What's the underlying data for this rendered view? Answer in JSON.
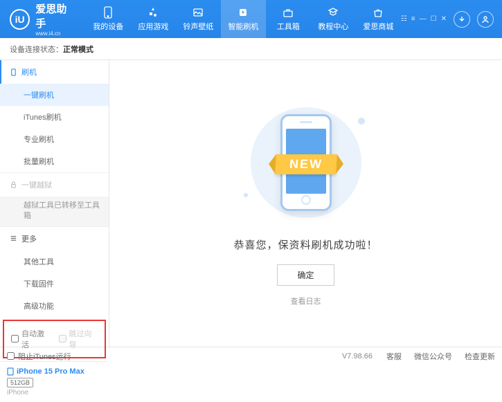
{
  "logo": {
    "glyph": "iU",
    "title": "爱思助手",
    "url": "www.i4.cn"
  },
  "nav": [
    {
      "label": "我的设备"
    },
    {
      "label": "应用游戏"
    },
    {
      "label": "铃声壁纸"
    },
    {
      "label": "智能刷机"
    },
    {
      "label": "工具箱"
    },
    {
      "label": "教程中心"
    },
    {
      "label": "爱思商城"
    }
  ],
  "status": {
    "prefix": "设备连接状态：",
    "value": "正常模式"
  },
  "sidebar": {
    "flash": {
      "header": "刷机",
      "items": [
        "一键刷机",
        "iTunes刷机",
        "专业刷机",
        "批量刷机"
      ]
    },
    "jailbreak": {
      "header": "一键越狱",
      "note": "越狱工具已转移至工具箱"
    },
    "more": {
      "header": "更多",
      "items": [
        "其他工具",
        "下载固件",
        "高级功能"
      ]
    },
    "checks": {
      "auto_activate": "自动激活",
      "skip_guide": "跳过向导"
    },
    "device": {
      "name": "iPhone 15 Pro Max",
      "storage": "512GB",
      "type": "iPhone"
    }
  },
  "main": {
    "ribbon": "NEW",
    "message": "恭喜您，保资料刷机成功啦！",
    "confirm": "确定",
    "log_link": "查看日志"
  },
  "footer": {
    "block_itunes": "阻止iTunes运行",
    "version": "V7.98.66",
    "links": [
      "客服",
      "微信公众号",
      "检查更新"
    ]
  }
}
